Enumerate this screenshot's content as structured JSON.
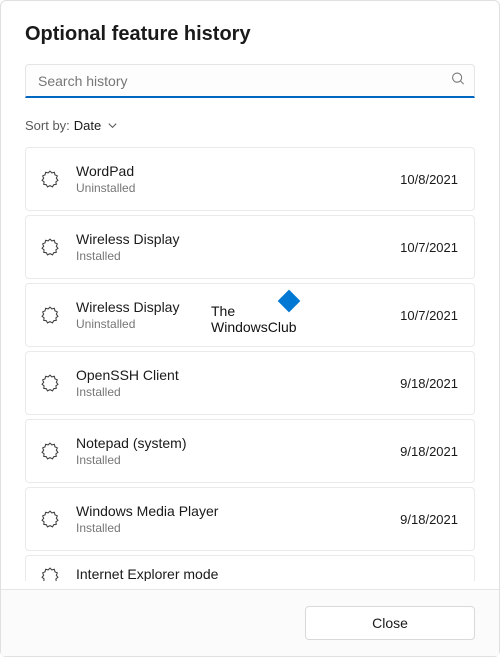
{
  "title": "Optional feature history",
  "search": {
    "placeholder": "Search history",
    "value": ""
  },
  "sort": {
    "label": "Sort by:",
    "value": "Date"
  },
  "items": [
    {
      "name": "WordPad",
      "status": "Uninstalled",
      "date": "10/8/2021"
    },
    {
      "name": "Wireless Display",
      "status": "Installed",
      "date": "10/7/2021"
    },
    {
      "name": "Wireless Display",
      "status": "Uninstalled",
      "date": "10/7/2021"
    },
    {
      "name": "OpenSSH Client",
      "status": "Installed",
      "date": "9/18/2021"
    },
    {
      "name": "Notepad (system)",
      "status": "Installed",
      "date": "9/18/2021"
    },
    {
      "name": "Windows Media Player",
      "status": "Installed",
      "date": "9/18/2021"
    },
    {
      "name": "Internet Explorer mode",
      "status": "",
      "date": ""
    }
  ],
  "footer": {
    "close": "Close"
  },
  "watermark": {
    "line1": "The",
    "line2": "WindowsClub"
  }
}
